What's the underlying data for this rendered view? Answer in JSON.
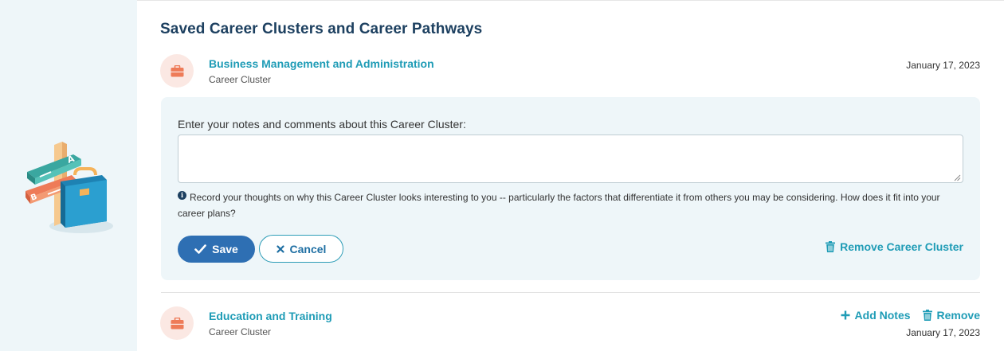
{
  "section": {
    "title": "Saved Career Clusters and Career Pathways"
  },
  "items": [
    {
      "title": "Business Management and Administration",
      "subtitle": "Career Cluster",
      "date": "January 17, 2023",
      "icon": "briefcase-icon"
    },
    {
      "title": "Education and Training",
      "subtitle": "Career Cluster",
      "date": "January 17, 2023",
      "icon": "briefcase-icon"
    }
  ],
  "notes": {
    "label": "Enter your notes and comments about this Career Cluster:",
    "value": "",
    "placeholder": "",
    "hint": "Record your thoughts on why this Career Cluster looks interesting to you -- particularly the factors that differentiate it from others you may be considering. How does it fit into your career plans?",
    "save_label": "Save",
    "cancel_label": "Cancel",
    "remove_label": "Remove Career Cluster"
  },
  "item_actions": {
    "add_notes_label": "Add Notes",
    "remove_label": "Remove"
  },
  "colors": {
    "accent": "#1f9cb6",
    "heading": "#1d4060",
    "save_button": "#2e6fb3",
    "panel_bg": "#eef6f9",
    "icon_circle": "#fbe8e3",
    "icon_fill": "#ee7b58"
  }
}
